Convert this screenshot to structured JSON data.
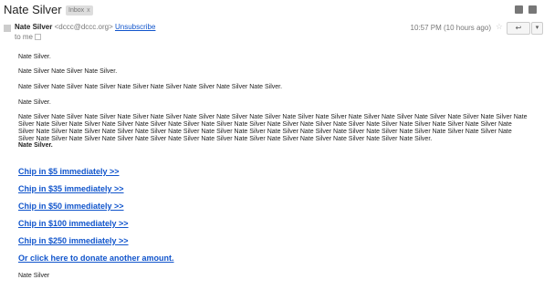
{
  "subject": "Nate Silver",
  "label_chip": "Inbox",
  "label_chip_close": "x",
  "sender": {
    "name": "Nate Silver",
    "email": "<dccc@dccc.org>",
    "unsubscribe": "Unsubscribe",
    "to": "to me"
  },
  "timestamp": "10:57 PM (10 hours ago)",
  "reply_glyph": "↩",
  "more_glyph": "▾",
  "star_glyph": "☆",
  "body": {
    "p1": "Nate Silver.",
    "p2": "Nate Silver Nate Silver Nate Silver.",
    "p3": "Nate Silver Nate Silver Nate Silver Nate Silver Nate Silver Nate Silver Nate Silver Nate Silver.",
    "p4": "Nate Silver.",
    "p5": "Nate Silver Nate Silver Nate Silver Nate Silver Nate Silver Nate Silver Nate Silver Nate Silver Nate Silver Nate Silver Nate Silver Nate Silver Nate Silver Nate Silver Nate Silver Nate Silver Nate Silver Nate Silver Nate Silver Nate Silver Nate Silver Nate Silver Nate Silver Nate Silver Nate Silver Nate Silver Nate Silver Nate Silver Nate Silver Nate Silver Nate Silver Nate Silver Nate Silver Nate Silver Nate Silver Nate Silver Nate Silver Nate Silver Nate Silver Nate Silver Nate Silver Nate Silver Nate Silver Nate Silver Nate Silver Nate Silver Nate Silver Nate Silver Nate Silver Nate Silver Nate Silver Nate Silver Nate Silver Nate Silver Nate Silver Nate Silver Nate Silver Nate Silver.",
    "p6": "Nate Silver."
  },
  "links": [
    "Chip in $5 immediately >>",
    "Chip in $35 immediately >>",
    "Chip in $50 immediately >>",
    "Chip in $100 immediately >>",
    "Chip in $250 immediately >>",
    "Or click here to donate another amount."
  ],
  "signature": "Nate Silver",
  "colors": {
    "link": "#1155cc",
    "text": "#222222",
    "muted": "#777777"
  }
}
